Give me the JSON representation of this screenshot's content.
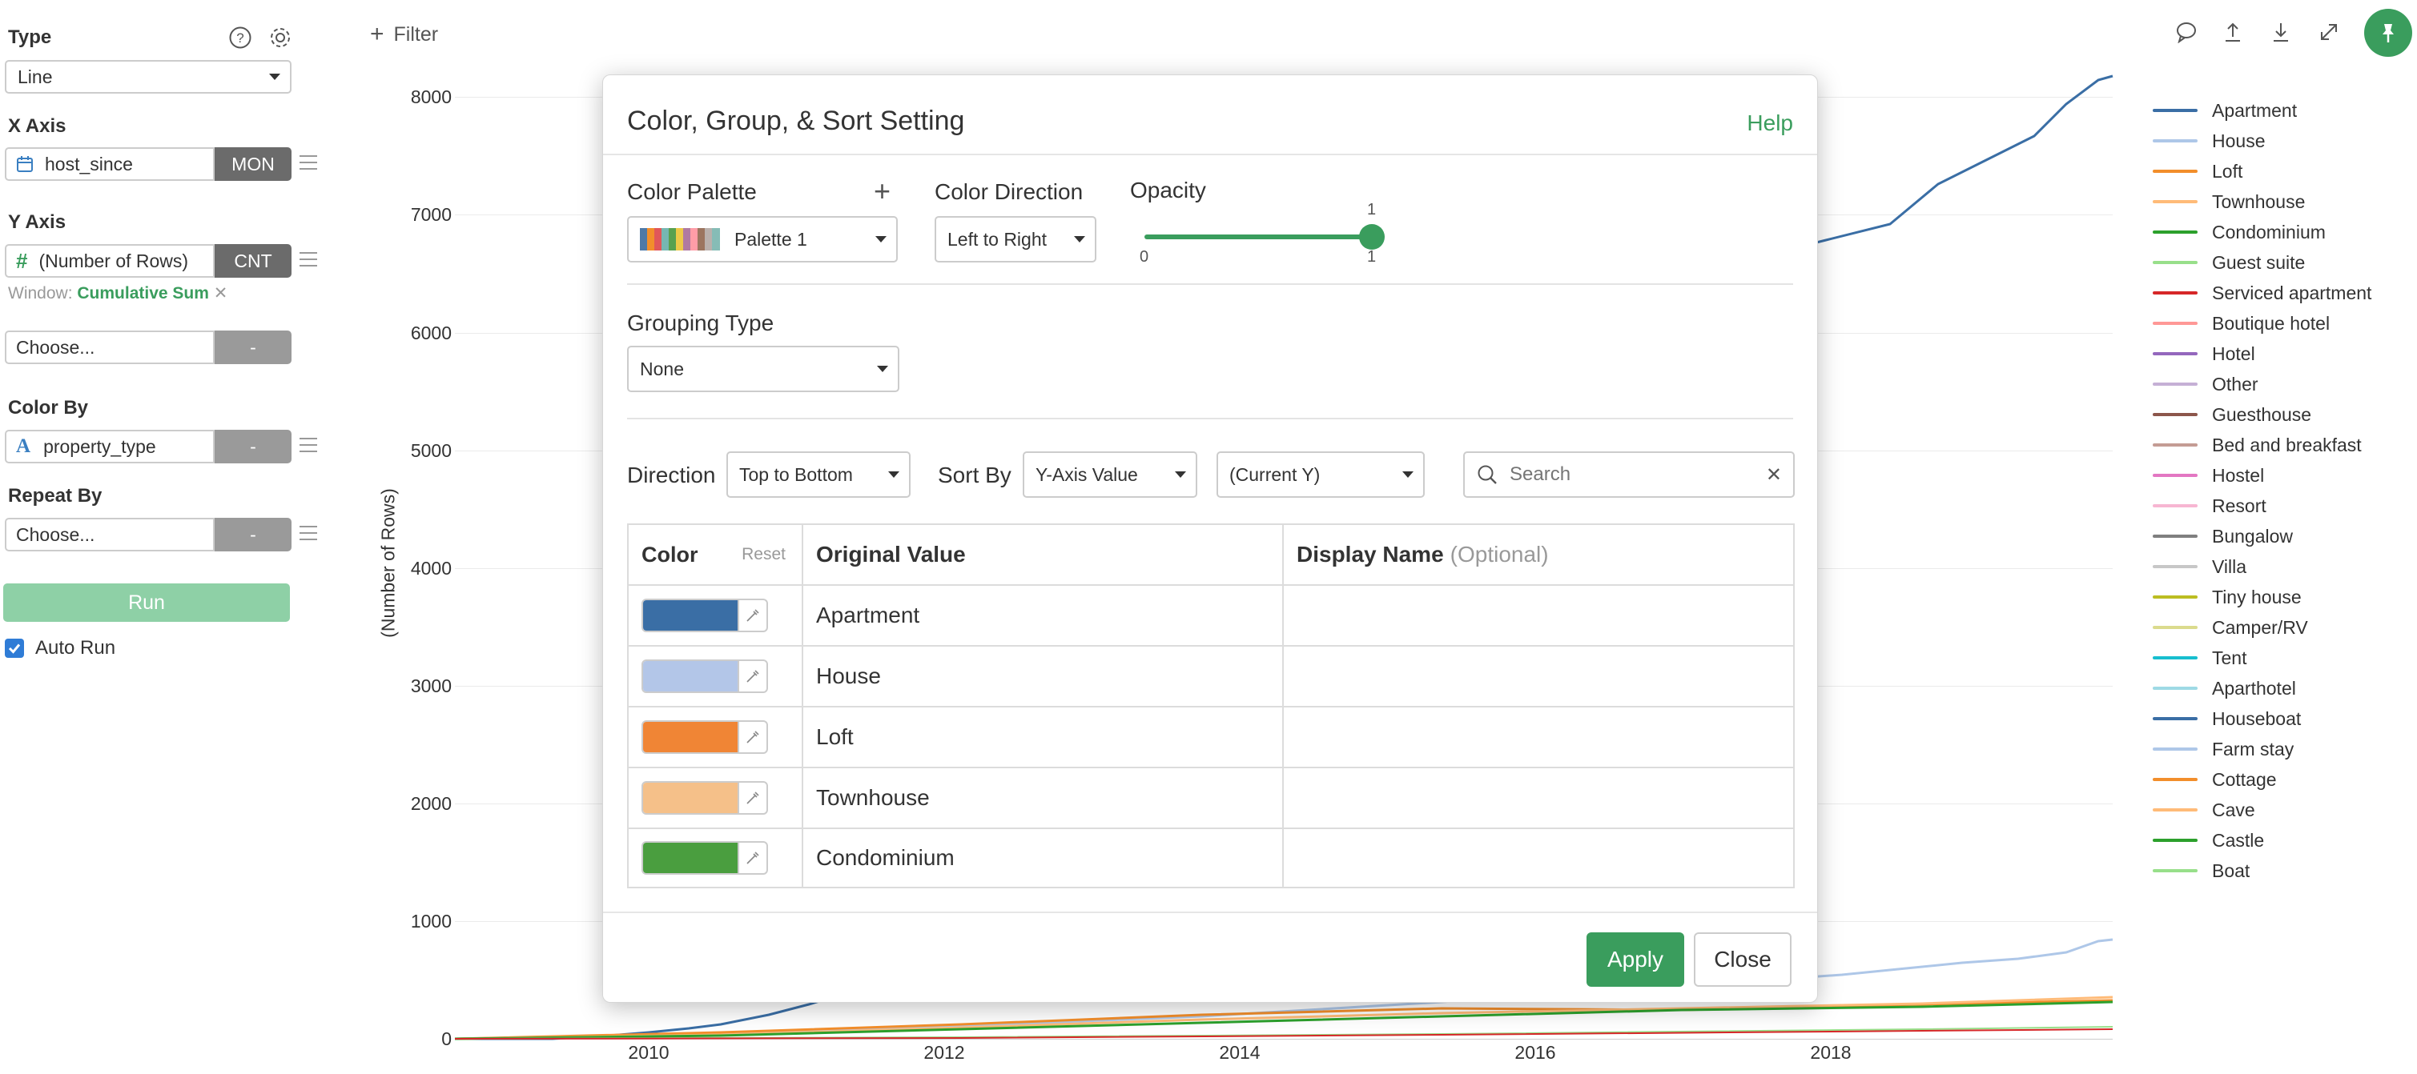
{
  "sidebar": {
    "type_label": "Type",
    "type_value": "Line",
    "xaxis_label": "X Axis",
    "xaxis_field": "host_since",
    "xaxis_btn": "MON",
    "yaxis_label": "Y Axis",
    "yaxis_field": "(Number of Rows)",
    "yaxis_btn": "CNT",
    "window_prefix": "Window:",
    "window_value": "Cumulative Sum",
    "choose1": "Choose...",
    "choose1_btn": "-",
    "colorby_label": "Color By",
    "colorby_field": "property_type",
    "colorby_btn": "-",
    "repeatby_label": "Repeat By",
    "repeatby_field": "Choose...",
    "repeatby_btn": "-",
    "run_label": "Run",
    "autorun_label": "Auto Run",
    "autorun_checked": true
  },
  "toolbar": {
    "filter_label": "Filter"
  },
  "chart": {
    "ylabel": "(Number of Rows)",
    "yticks": [
      "8000",
      "7000",
      "6000",
      "5000",
      "4000",
      "3000",
      "2000",
      "1000",
      "0"
    ],
    "xticks": [
      "2010",
      "2012",
      "2014",
      "2016",
      "2018"
    ]
  },
  "legend": [
    {
      "label": "Apartment",
      "color": "#3a6ea5"
    },
    {
      "label": "House",
      "color": "#aec7e8"
    },
    {
      "label": "Loft",
      "color": "#f28e2b"
    },
    {
      "label": "Townhouse",
      "color": "#ffbb78"
    },
    {
      "label": "Condominium",
      "color": "#2ca02c"
    },
    {
      "label": "Guest suite",
      "color": "#98df8a"
    },
    {
      "label": "Serviced apartment",
      "color": "#d62728"
    },
    {
      "label": "Boutique hotel",
      "color": "#ff9896"
    },
    {
      "label": "Hotel",
      "color": "#9467bd"
    },
    {
      "label": "Other",
      "color": "#c5b0d5"
    },
    {
      "label": "Guesthouse",
      "color": "#8c564b"
    },
    {
      "label": "Bed and breakfast",
      "color": "#c49c94"
    },
    {
      "label": "Hostel",
      "color": "#e377c2"
    },
    {
      "label": "Resort",
      "color": "#f7b6d2"
    },
    {
      "label": "Bungalow",
      "color": "#7f7f7f"
    },
    {
      "label": "Villa",
      "color": "#c7c7c7"
    },
    {
      "label": "Tiny house",
      "color": "#bcbd22"
    },
    {
      "label": "Camper/RV",
      "color": "#dbdb8d"
    },
    {
      "label": "Tent",
      "color": "#17becf"
    },
    {
      "label": "Aparthotel",
      "color": "#9edae5"
    },
    {
      "label": "Houseboat",
      "color": "#3a6ea5"
    },
    {
      "label": "Farm stay",
      "color": "#aec7e8"
    },
    {
      "label": "Cottage",
      "color": "#f28e2b"
    },
    {
      "label": "Cave",
      "color": "#ffbb78"
    },
    {
      "label": "Castle",
      "color": "#2ca02c"
    },
    {
      "label": "Boat",
      "color": "#98df8a"
    }
  ],
  "modal": {
    "title": "Color, Group, & Sort Setting",
    "help": "Help",
    "palette_label": "Color Palette",
    "palette_value": "Palette 1",
    "palette_colors": [
      "#4e79a7",
      "#f28e2b",
      "#e15759",
      "#76b7b2",
      "#59a14f",
      "#edc948",
      "#b07aa1",
      "#ff9da7",
      "#9c755f",
      "#bab0ac",
      "#86bcb6"
    ],
    "direction_label": "Color Direction",
    "direction_value": "Left to Right",
    "opacity_label": "Opacity",
    "opacity_min": "0",
    "opacity_max": "1",
    "opacity_value_label": "1",
    "opacity_value": 1,
    "grouping_label": "Grouping Type",
    "grouping_value": "None",
    "sort_direction_label": "Direction",
    "sort_direction_value": "Top to Bottom",
    "sortby_label": "Sort By",
    "sortby_value": "Y-Axis Value",
    "sortby_sub": "(Current Y)",
    "search_placeholder": "Search",
    "table_head_color": "Color",
    "table_head_reset": "Reset",
    "table_head_original": "Original Value",
    "table_head_display": "Display Name",
    "table_head_optional": "(Optional)",
    "rows": [
      {
        "value": "Apartment",
        "color": "#3a6ea5"
      },
      {
        "value": "House",
        "color": "#b3c6e8"
      },
      {
        "value": "Loft",
        "color": "#f08535"
      },
      {
        "value": "Townhouse",
        "color": "#f5c089"
      },
      {
        "value": "Condominium",
        "color": "#4a9e3f"
      }
    ],
    "apply": "Apply",
    "close": "Close"
  }
}
